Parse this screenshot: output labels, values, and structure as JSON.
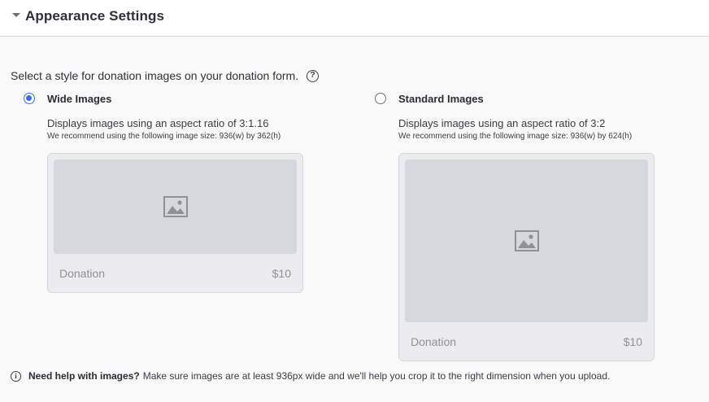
{
  "header": {
    "title": "Appearance Settings"
  },
  "intro": {
    "text": "Select a style for donation images on your donation form.",
    "help_icon": "?"
  },
  "options": [
    {
      "title": "Wide Images",
      "selected": true,
      "description": "Displays images using an aspect ratio of 3:1.16",
      "recommendation": "We recommend using the following image size: 936(w) by 362(h)",
      "preview": {
        "caption": "Donation",
        "amount": "$10"
      }
    },
    {
      "title": "Standard Images",
      "selected": false,
      "description": "Displays images using an aspect ratio of 3:2",
      "recommendation": "We recommend using the following image size: 936(w) by 624(h)",
      "preview": {
        "caption": "Donation",
        "amount": "$10"
      }
    }
  ],
  "footer": {
    "info_icon": "i",
    "bold": "Need help with images?",
    "text": "Make sure images are at least 936px wide and we'll help you crop it to the right dimension when you upload."
  },
  "colors": {
    "accent": "#3b6fdc",
    "placeholder": "#d5d8dc",
    "card": "#ececee"
  }
}
